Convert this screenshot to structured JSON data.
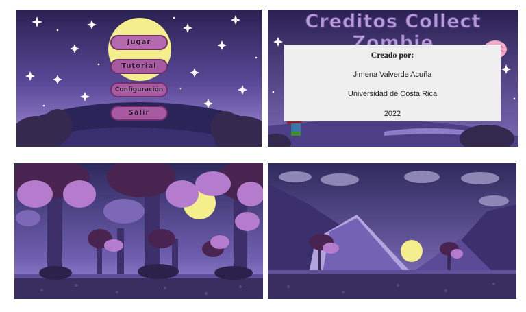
{
  "menu": {
    "play": "Jugar",
    "tutorial": "Tutorial",
    "settings": "Configuración",
    "exit": "Salir"
  },
  "credits": {
    "title": "Creditos Collect Zombie",
    "heading": "Creado por:",
    "author": "Jimena Valverde Acuña",
    "institution": "Universidad de Costa Rica",
    "year": "2022"
  },
  "colors": {
    "sky_top": "#2c2358",
    "sky_bottom": "#a38fd6",
    "moon": "#f5ee8c",
    "button": "#a85aa0",
    "button_border": "#6e2e6b",
    "zombie": "#3e8e2b",
    "brain": "#f4a7c4",
    "foliage_dark": "#5d2b5f",
    "foliage_light": "#b67ad0"
  }
}
